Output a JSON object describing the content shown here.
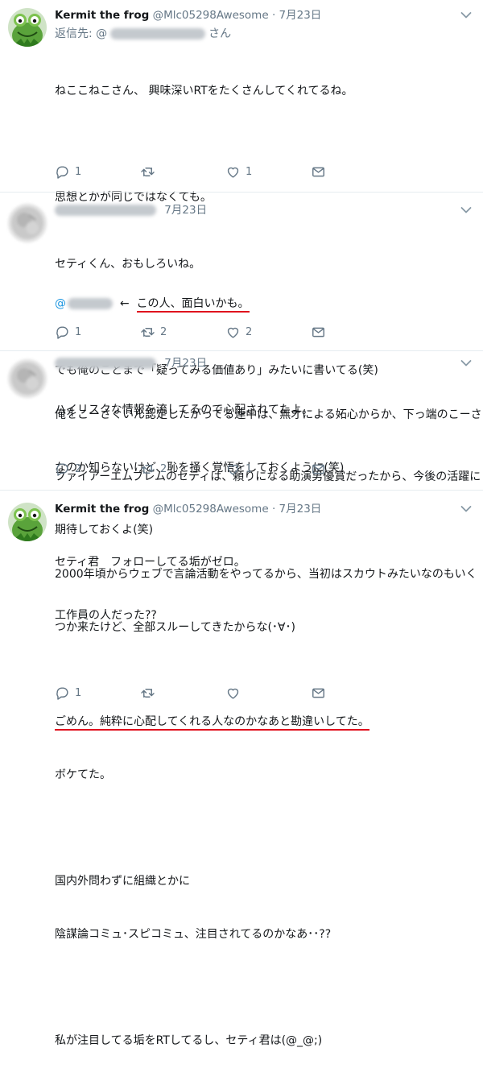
{
  "tweets": [
    {
      "name": "Kermit the frog",
      "handle": "@Mlc05298Awesome",
      "dot": "·",
      "date": "7月23日",
      "reply_prefix": "返信先: @",
      "reply_suffix": "さん",
      "lines": [
        "ねここねこさん、 興味深いRTをたくさんしてくれてるね。",
        "",
        "思想とかが同じではなくても。",
        "",
        "",
        "",
        "ハイリスクな情報を流してるので心配されてたよ。"
      ],
      "mention_prefix": "@",
      "arrow": "←",
      "highlight": "この人、面白いかも。",
      "replies": "1",
      "retweets": "",
      "likes": "1"
    },
    {
      "date": "7月23日",
      "lines": [
        "セティくん、おもしろいね。",
        "",
        "でも俺のことまで「疑ってみる価値あり」みたいに書いてる(笑)",
        "",
        "ファイアーエムブレムのセティは、頼りになる助演男優賞だったから、今後の活躍に",
        "期待しておくよ(笑)"
      ],
      "replies": "1",
      "retweets": "2",
      "likes": "2"
    },
    {
      "date": "7月23日",
      "lines": [
        "俺をこーさくいん認定したがってる連中は、無才による妬心からか、下っ端のこーさく",
        "なのか知らないけど、恥を掻く覚悟をしておくように(笑)",
        "",
        "2000年頃からウェブで言論活動をやってるから、当初はスカウトみたいなのもいく",
        "つか来たけど、全部スルーしてきたからな(･∀･)"
      ],
      "replies": "2",
      "retweets": "2",
      "likes": "1"
    },
    {
      "name": "Kermit the frog",
      "handle": "@Mlc05298Awesome",
      "dot": "·",
      "date": "7月23日",
      "lines": [
        "セティ君　フォローしてる垢がゼロ。",
        "工作員の人だった??",
        "",
        "ごめん。純粋に心配してくれる人なのかなあと勘違いしてた。",
        "ボケてた。",
        "",
        "国内外問わずに組織とかに",
        "陰謀論コミュ･スピコミュ、注目されてるのかなあ･･??",
        "",
        "私が注目してる垢をRTしてるし、セティ君は(@_@;)"
      ],
      "replies": "1",
      "retweets": "",
      "likes": ""
    }
  ],
  "colors": {
    "text": "#14171a",
    "secondary": "#657786",
    "link": "#1b95e0",
    "underline": "#e0101d",
    "divider": "#e6ecf0"
  },
  "icons": [
    "reply-icon",
    "retweet-icon",
    "like-icon",
    "dm-icon",
    "chevron-down-icon"
  ]
}
